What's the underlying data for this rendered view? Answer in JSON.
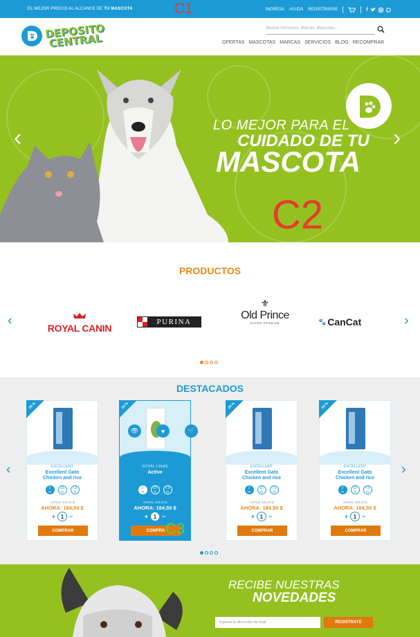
{
  "topbar": {
    "promo_prefix": "EL MEJOR PRECIO AL ALCANCE DE ",
    "promo_bold": "TU MASCOTA",
    "annotation": "C1",
    "links": [
      "INGRESA",
      "AYUDA",
      "REGISTRARSE"
    ]
  },
  "header": {
    "logo_line1": "DEPOSITO",
    "logo_line2": "CENTRAL",
    "search_placeholder": "Buscar Alimentos, Marcas, Mascotas...",
    "nav": [
      "OFERTAS",
      "MASCOTAS",
      "MARCAS",
      "SERVICIOS",
      "BLOG",
      "RECOMPRAR"
    ]
  },
  "hero": {
    "line1": "LO MEJOR PARA EL",
    "line2": "CUIDADO DE TU",
    "line3": "MASCOTA",
    "annotation": "C2"
  },
  "products": {
    "title": "PRODUCTOS",
    "brands": [
      "ROYAL CANIN",
      "PURINA",
      "Old Prince",
      "CanCat"
    ],
    "old_prince_sub": "SUPER PREMIUM"
  },
  "destacados": {
    "title": "DESTACADOS",
    "cards": [
      {
        "ribbon": "20 %",
        "brand": "EXCELLENT",
        "name": "Excellent Gato Chicken and rice",
        "sizes": [
          "2",
          "15",
          "7,5"
        ],
        "size_unit": "kg",
        "antes": "ANTES: 205,00 $",
        "ahora": "AHORA: 184,50 $",
        "qty": "1",
        "buy": "COMPRAR",
        "active": false
      },
      {
        "ribbon": "20 %",
        "brand": "ROYAL CANIN",
        "name": "Active",
        "sizes": [
          "2",
          "15",
          "7,5"
        ],
        "size_unit": "kg",
        "antes": "ANTES: 205,00 $",
        "ahora": "AHORA: 184,50 $",
        "qty": "1",
        "buy": "COMPRA",
        "active": true
      },
      {
        "ribbon": "20 %",
        "brand": "EXCELLENT",
        "name": "Excellent Gato Chicken and rice",
        "sizes": [
          "2",
          "15",
          "7,5"
        ],
        "size_unit": "kg",
        "antes": "ANTES: 205,00 $",
        "ahora": "AHORA: 184,50 $",
        "qty": "1",
        "buy": "COMPRAR",
        "active": false
      },
      {
        "ribbon": "20 %",
        "brand": "EXCELLENT",
        "name": "Excellent Gato Chicken and rice",
        "sizes": [
          "2",
          "15",
          "7,5"
        ],
        "size_unit": "kg",
        "antes": "ANTES: 205,00 $",
        "ahora": "AHORA: 184,50 $",
        "qty": "1",
        "buy": "COMPRAR",
        "active": false
      }
    ],
    "annotation": "C3"
  },
  "newsletter": {
    "line1": "RECIBE NUESTRAS",
    "line2": "NOVEDADES",
    "email_placeholder": "Ingresa tu dirección de mail",
    "button": "REGISTRATE"
  },
  "colors": {
    "blue": "#1c9ad6",
    "green": "#94c120",
    "orange": "#e98a1b",
    "annotation_red": "#e53b2c"
  }
}
